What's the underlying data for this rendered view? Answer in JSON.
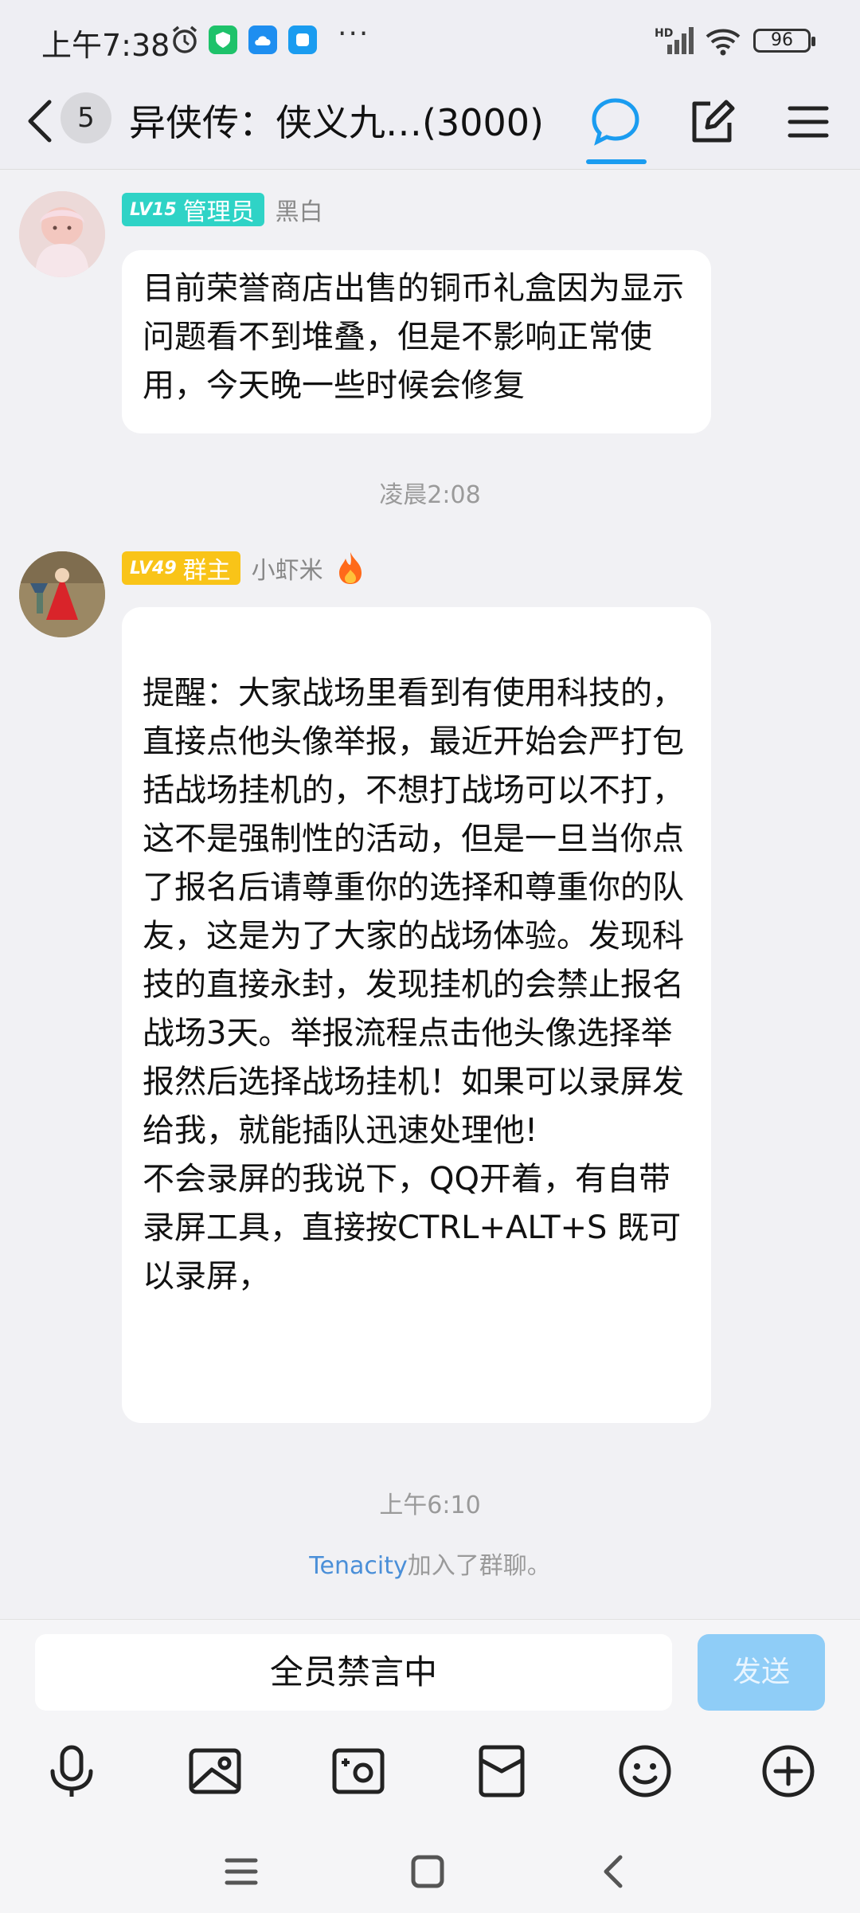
{
  "status_bar": {
    "time": "上午7:38",
    "network": "HD",
    "battery": "96"
  },
  "header": {
    "unread_count": "5",
    "group_title": "异侠传：侠义九…(3000)"
  },
  "messages": [
    {
      "level": "LV15",
      "role": "管理员",
      "nickname": "黑白",
      "text": "目前荣誉商店出售的铜币礼盒因为显示问题看不到堆叠，但是不影响正常使用，今天晚一些时候会修复"
    },
    {
      "timestamp": "凌晨2:08"
    },
    {
      "level": "LV49",
      "role": "群主",
      "nickname": "小虾米",
      "paragraphs": [
        "提醒：大家战场里看到有使用科技的，直接点他头像举报，最近开始会严打包括战场挂机的，不想打战场可以不打，这不是强制性的活动，但是一旦当你点了报名后请尊重你的选择和尊重你的队友，这是为了大家的战场体验。发现科技的直接永封，发现挂机的会禁止报名战场3天。举报流程点击他头像选择举报然后选择战场挂机！如果可以录屏发给我，就能插队迅速处理他!",
        "不会录屏的我说下，QQ开着，有自带录屏工具，直接按CTRL+ALT+S 既可以录屏，"
      ]
    },
    {
      "timestamp": "上午6:10"
    },
    {
      "system_user": "Tenacity",
      "system_text": "加入了群聊。"
    }
  ],
  "input": {
    "placeholder": "全员禁言中",
    "send_label": "发送"
  },
  "colors": {
    "accent": "#1a9cf0",
    "admin_badge": "#2fd3c6",
    "owner_badge": "#f9c418",
    "send_disabled": "#8fcdf7"
  },
  "toolbar_icons": [
    "microphone-icon",
    "image-icon",
    "camera-icon",
    "red-envelope-icon",
    "emoji-icon",
    "plus-icon"
  ]
}
